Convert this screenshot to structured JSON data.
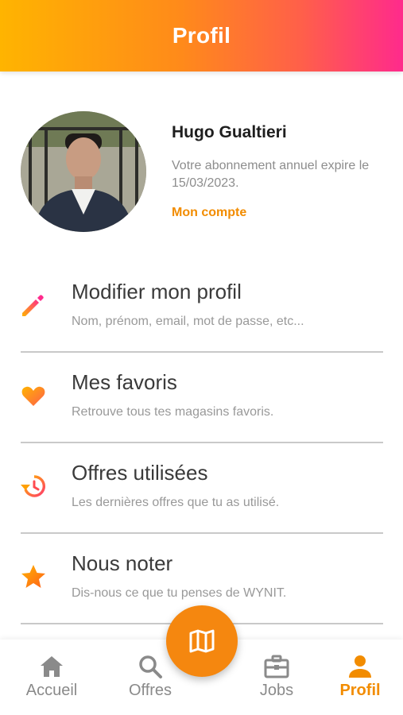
{
  "colors": {
    "accent": "#f28c00",
    "header_gradient": [
      "#ffb400",
      "#ff8a1a",
      "#ff2a8c"
    ],
    "text_primary": "#1e1e1e",
    "text_secondary": "#8d8d8d",
    "divider": "#c9c9c9"
  },
  "header": {
    "title": "Profil"
  },
  "profile": {
    "name": "Hugo Gualtieri",
    "subscription_text": "Votre abonnement annuel expire le 15/03/2023.",
    "account_link": "Mon compte"
  },
  "menu": {
    "items": [
      {
        "title": "Modifier mon profil",
        "description": "Nom, prénom, email, mot de passe, etc...",
        "icon": "pencil-icon"
      },
      {
        "title": "Mes favoris",
        "description": "Retrouve tous tes magasins favoris.",
        "icon": "heart-icon"
      },
      {
        "title": "Offres utilisées",
        "description": "Les dernières offres que tu as utilisé.",
        "icon": "history-icon"
      },
      {
        "title": "Nous noter",
        "description": "Dis-nous ce que tu penses de WYNIT.",
        "icon": "star-icon"
      }
    ]
  },
  "bottom_nav": {
    "items": [
      {
        "label": "Accueil",
        "icon": "home-icon",
        "active": false
      },
      {
        "label": "Offres",
        "icon": "search-icon",
        "active": false
      },
      {
        "label": "Jobs",
        "icon": "briefcase-icon",
        "active": false
      },
      {
        "label": "Profil",
        "icon": "person-icon",
        "active": true
      }
    ],
    "fab_icon": "map-icon"
  }
}
